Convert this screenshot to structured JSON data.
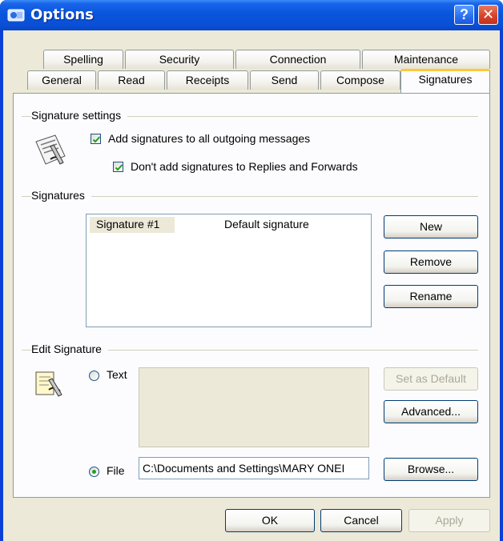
{
  "window": {
    "title": "Options",
    "help_glyph": "?",
    "close_glyph": "✕"
  },
  "tabs_back": [
    "Spelling",
    "Security",
    "Connection",
    "Maintenance"
  ],
  "tabs_front": [
    "General",
    "Read",
    "Receipts",
    "Send",
    "Compose",
    "Signatures"
  ],
  "active_tab": "Signatures",
  "signature_settings": {
    "heading": "Signature settings",
    "add_all": {
      "label": "Add signatures to all outgoing messages",
      "checked": true
    },
    "dont_add_replies": {
      "label": "Don't add signatures to Replies and Forwards",
      "checked": true
    }
  },
  "signatures": {
    "heading": "Signatures",
    "list": [
      {
        "name": "Signature #1",
        "note": "Default signature"
      }
    ],
    "new_label": "New",
    "remove_label": "Remove",
    "rename_label": "Rename"
  },
  "edit_signature": {
    "heading": "Edit Signature",
    "text_option": {
      "label": "Text",
      "selected": false
    },
    "file_option": {
      "label": "File",
      "selected": true
    },
    "file_path": "C:\\Documents and Settings\\MARY ONEI",
    "set_default_label": "Set as Default",
    "advanced_label": "Advanced...",
    "browse_label": "Browse..."
  },
  "footer": {
    "ok_label": "OK",
    "cancel_label": "Cancel",
    "apply_label": "Apply"
  },
  "colors": {
    "titlebar": "#0856dd",
    "dialog_bg": "#ece9d8",
    "active_tab_accent": "#ffc83c"
  },
  "icons": [
    "app-icon",
    "help-icon",
    "close-icon",
    "signature-pen-icon",
    "edit-signature-icon"
  ]
}
